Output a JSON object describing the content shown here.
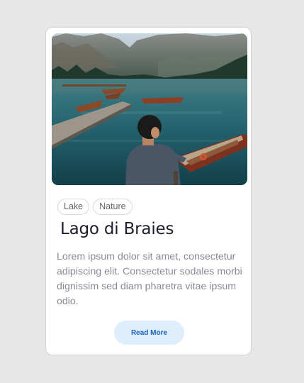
{
  "card": {
    "image_alt": "Man sitting on a dock by a mountain lake with wooden boats",
    "tags": [
      "Lake",
      "Nature"
    ],
    "title": "Lago di Braies",
    "description": "Lorem ipsum dolor sit amet, consectetur adipiscing elit. Consectetur sodales morbi dignissim sed diam pharetra vitae ipsum odio.",
    "button_label": "Read More"
  },
  "colors": {
    "page_background": "#e7e7e7",
    "card_background": "#ffffff",
    "title": "#1b1e2b",
    "description": "#8a8a96",
    "button_background": "#dfeefd",
    "button_text": "#1b63b8"
  }
}
